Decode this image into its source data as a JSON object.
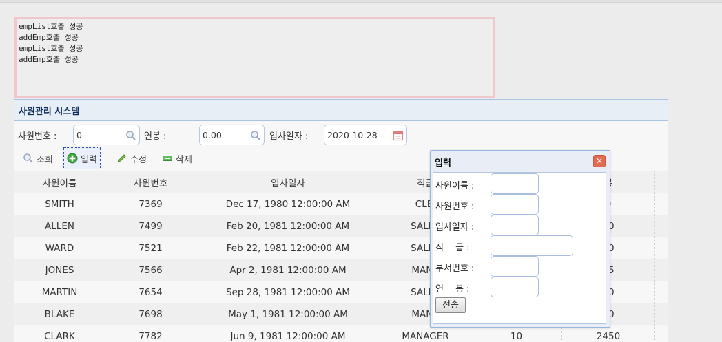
{
  "log_lines": [
    "empList호출 성공",
    "addEmp호출 성공",
    "empList호출 성공",
    "addEmp호출 성공"
  ],
  "panel": {
    "title": "사원관리 시스템"
  },
  "search": {
    "empno_label": "사원번호 :",
    "empno_value": "0",
    "sal_label": "연봉 :",
    "sal_value": "0.00",
    "hiredate_label": "입사일자 :",
    "hiredate_value": "2020-10-28"
  },
  "toolbar": {
    "search_label": "조회",
    "insert_label": "입력",
    "update_label": "수정",
    "delete_label": "삭제"
  },
  "grid": {
    "headers": [
      "사원이름",
      "사원번호",
      "입사일자",
      "직급",
      "",
      "봉"
    ],
    "rows": [
      [
        "SMITH",
        "7369",
        "Dec 17, 1980 12:00:00 AM",
        "CLEI",
        "",
        "0"
      ],
      [
        "ALLEN",
        "7499",
        "Feb 20, 1981 12:00:00 AM",
        "SALES",
        "",
        "00"
      ],
      [
        "WARD",
        "7521",
        "Feb 22, 1981 12:00:00 AM",
        "SALES",
        "",
        "50"
      ],
      [
        "JONES",
        "7566",
        "Apr 2, 1981 12:00:00 AM",
        "MANA",
        "",
        "75"
      ],
      [
        "MARTIN",
        "7654",
        "Sep 28, 1981 12:00:00 AM",
        "SALES",
        "",
        "50"
      ],
      [
        "BLAKE",
        "7698",
        "May 1, 1981 12:00:00 AM",
        "MANA",
        "",
        "50"
      ],
      [
        "CLARK",
        "7782",
        "Jun 9, 1981 12:00:00 AM",
        "MANAGER",
        "10",
        "2450"
      ]
    ]
  },
  "dialog": {
    "title": "입력",
    "fields": [
      {
        "label": "사원이름 :"
      },
      {
        "label": "사원번호 :"
      },
      {
        "label": "입사일자 :"
      },
      {
        "label": "직　 급 :"
      },
      {
        "label": "부서번호 :"
      },
      {
        "label": "연　 봉 :"
      }
    ],
    "submit_label": "전송"
  },
  "colors": {
    "accent": "#0e2d5f",
    "border": "#a8c4e4",
    "log_border": "#f0c8cc",
    "close": "#e26b52",
    "insert_green": "#3aa53a"
  }
}
